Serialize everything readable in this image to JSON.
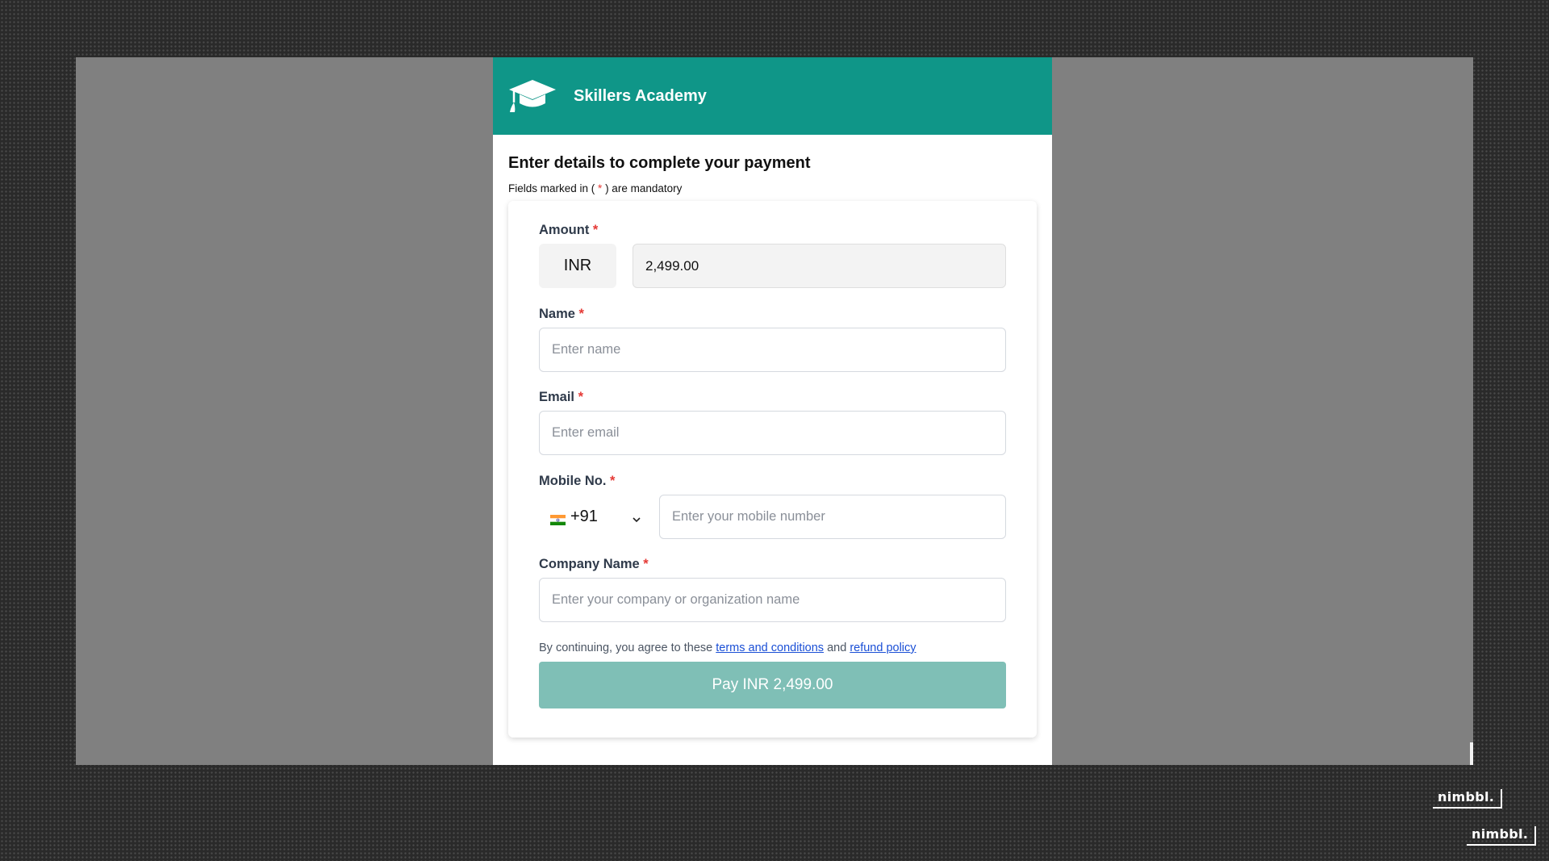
{
  "brand": {
    "name": "Skillers Academy",
    "header_color": "#0f9688"
  },
  "intro": {
    "title": "Enter details to complete your payment",
    "note_prefix": "Fields marked in ( ",
    "note_star": "*",
    "note_suffix": " ) are mandatory"
  },
  "form": {
    "amount": {
      "label": "Amount",
      "currency": "INR",
      "value": "2,499.00"
    },
    "name": {
      "label": "Name",
      "placeholder": "Enter name"
    },
    "email": {
      "label": "Email",
      "placeholder": "Enter email"
    },
    "mobile": {
      "label": "Mobile No.",
      "country_code": "+91",
      "placeholder": "Enter your mobile number"
    },
    "company": {
      "label": "Company Name",
      "placeholder": "Enter your company or organization name"
    },
    "required_mark": "*"
  },
  "terms": {
    "prefix": "By continuing, you agree to these ",
    "terms_link": "terms and conditions",
    "middle": " and ",
    "refund_link": "refund policy"
  },
  "pay_button": {
    "label": "Pay INR 2,499.00",
    "color": "#7fbfb6"
  },
  "watermark": {
    "text": "nimbbl."
  }
}
